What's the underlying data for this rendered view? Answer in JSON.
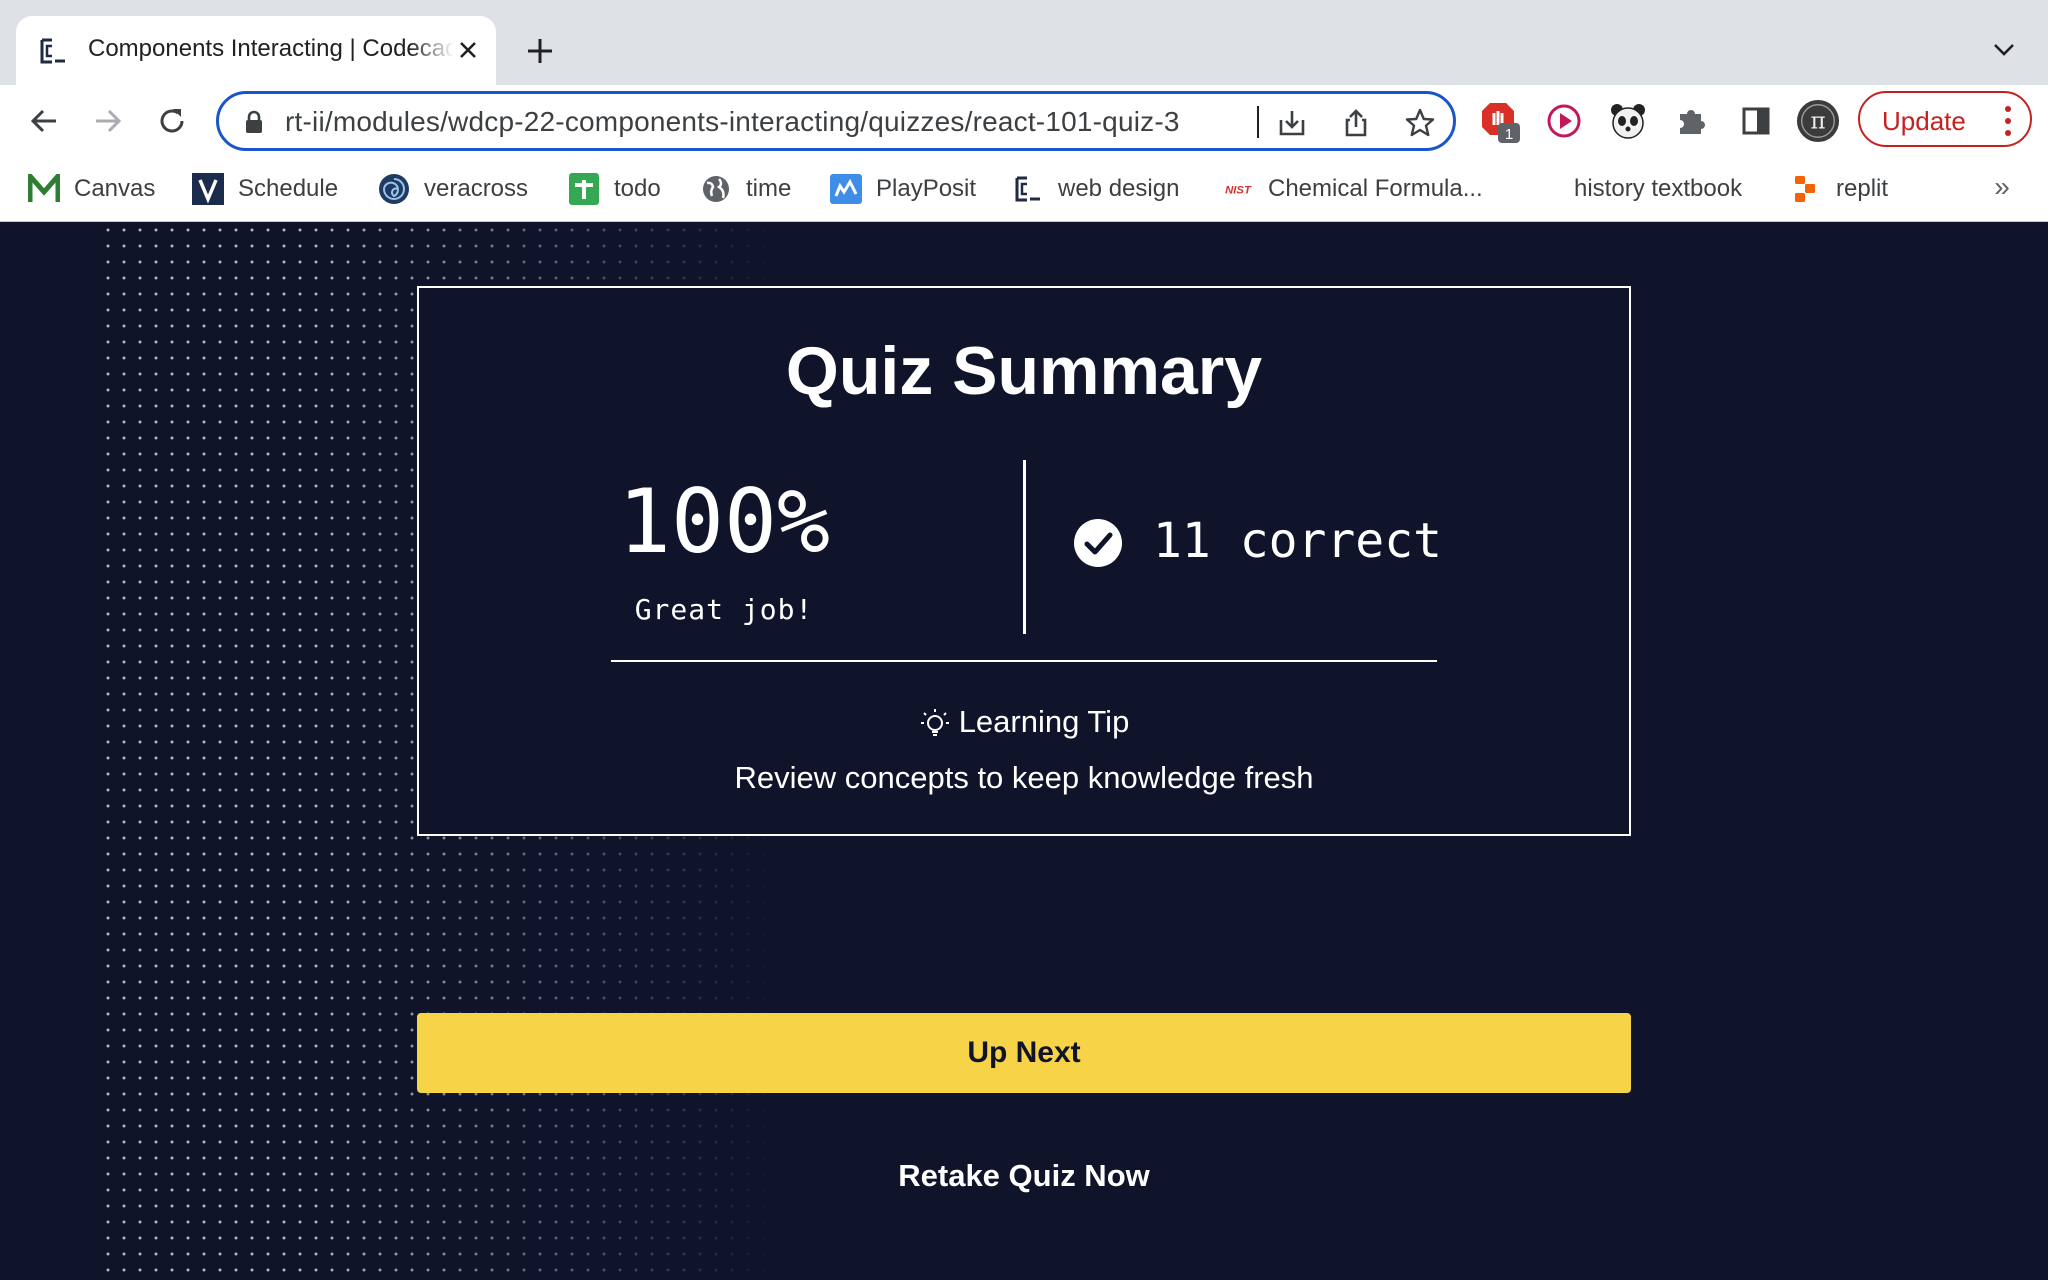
{
  "browser": {
    "tab": {
      "title": "Components Interacting | Codecademy"
    },
    "address_bar": {
      "url": "rt-ii/modules/wdcp-22-components-interacting/quizzes/react-101-quiz-3"
    },
    "extensions_badge": "1",
    "update_label": "Update",
    "bookmarks": [
      {
        "label": "Canvas",
        "icon": "canvas-logo"
      },
      {
        "label": "Schedule",
        "icon": "veracross-v-logo"
      },
      {
        "label": "veracross",
        "icon": "veracross-swirl-logo"
      },
      {
        "label": "todo",
        "icon": "google-sheets-icon"
      },
      {
        "label": "time",
        "icon": "globe-icon"
      },
      {
        "label": "PlayPosit",
        "icon": "playposit-logo"
      },
      {
        "label": "web design",
        "icon": "codecademy-logo"
      },
      {
        "label": "Chemical Formula...",
        "icon": "nist-logo",
        "icon_text": "NIST"
      },
      {
        "label": "history textbook",
        "icon": ""
      },
      {
        "label": "replit",
        "icon": "replit-logo"
      }
    ],
    "more_bookmarks": "»"
  },
  "quiz": {
    "title": "Quiz Summary",
    "score": "100%",
    "score_message": "Great job!",
    "correct_text": "11 correct",
    "tip_title": "Learning Tip",
    "tip_text": "Review concepts to keep knowledge fresh",
    "up_next_label": "Up Next",
    "retake_label": "Retake Quiz Now"
  },
  "colors": {
    "page_background": "#10142a",
    "accent_yellow": "#f7d348",
    "update_red": "#c5221f",
    "focus_blue": "#1a56c9"
  }
}
